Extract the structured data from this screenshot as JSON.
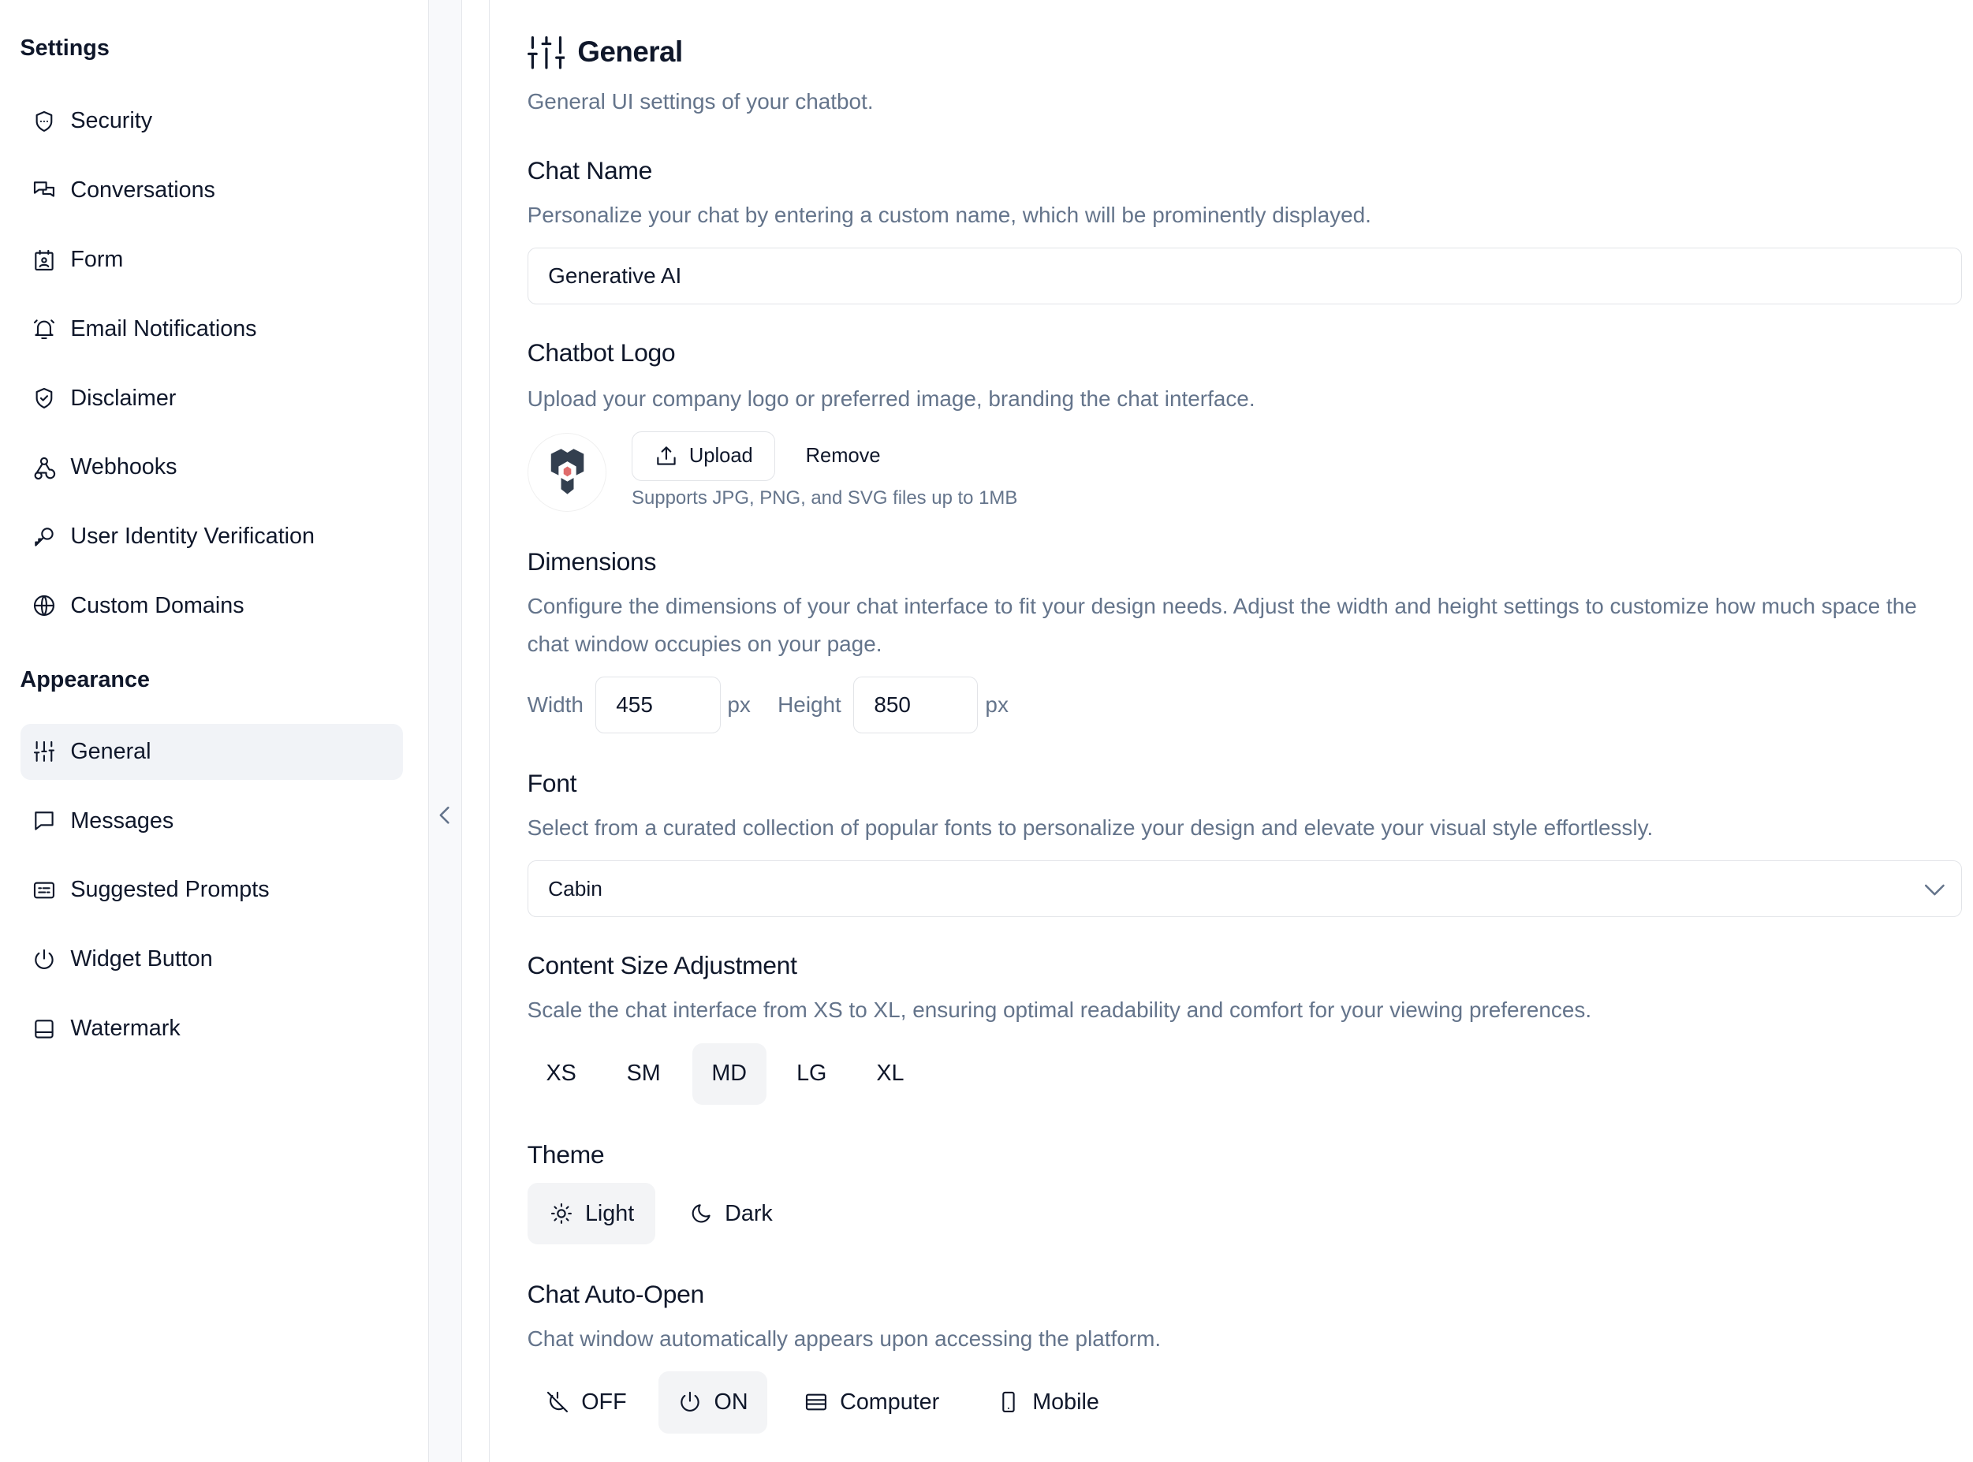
{
  "sidebar": {
    "settings_title": "Settings",
    "settings_items": [
      {
        "label": "Security",
        "icon": "shield-icon"
      },
      {
        "label": "Conversations",
        "icon": "messages-icon"
      },
      {
        "label": "Form",
        "icon": "form-icon"
      },
      {
        "label": "Email Notifications",
        "icon": "bell-icon"
      },
      {
        "label": "Disclaimer",
        "icon": "shield-check-icon"
      },
      {
        "label": "Webhooks",
        "icon": "webhook-icon"
      },
      {
        "label": "User Identity Verification",
        "icon": "key-icon"
      },
      {
        "label": "Custom Domains",
        "icon": "globe-icon"
      }
    ],
    "appearance_title": "Appearance",
    "appearance_items": [
      {
        "label": "General",
        "icon": "sliders-icon",
        "active": true
      },
      {
        "label": "Messages",
        "icon": "message-icon"
      },
      {
        "label": "Suggested Prompts",
        "icon": "prompts-icon"
      },
      {
        "label": "Widget Button",
        "icon": "power-icon"
      },
      {
        "label": "Watermark",
        "icon": "watermark-icon"
      }
    ]
  },
  "page": {
    "title": "General",
    "subtitle": "General UI settings of your chatbot."
  },
  "chat_name": {
    "label": "Chat Name",
    "description": "Personalize your chat by entering a custom name, which will be prominently displayed.",
    "value": "Generative AI"
  },
  "logo": {
    "label": "Chatbot Logo",
    "description": "Upload your company logo or preferred image, branding the chat interface.",
    "upload": "Upload",
    "remove": "Remove",
    "hint": "Supports JPG, PNG, and SVG files up to 1MB",
    "accent": "#e06c6c",
    "dark": "#333f4f"
  },
  "dimensions": {
    "label": "Dimensions",
    "description": "Configure the dimensions of your chat interface to fit your design needs. Adjust the width and height settings to customize how much space the chat window occupies on your page.",
    "width_label": "Width",
    "width": "455",
    "height_label": "Height",
    "height": "850",
    "unit": "px"
  },
  "font": {
    "label": "Font",
    "description": "Select from a curated collection of popular fonts to personalize your design and elevate your visual style effortlessly.",
    "value": "Cabin"
  },
  "content_size": {
    "label": "Content Size Adjustment",
    "description": "Scale the chat interface from XS to XL, ensuring optimal readability and comfort for your viewing preferences.",
    "options": [
      "XS",
      "SM",
      "MD",
      "LG",
      "XL"
    ],
    "selected": "MD"
  },
  "theme": {
    "label": "Theme",
    "options": [
      "Light",
      "Dark"
    ],
    "selected": "Light"
  },
  "auto_open": {
    "label": "Chat Auto-Open",
    "description": "Chat window automatically appears upon accessing the platform.",
    "options": [
      "OFF",
      "ON",
      "Computer",
      "Mobile"
    ],
    "selected": "ON"
  }
}
